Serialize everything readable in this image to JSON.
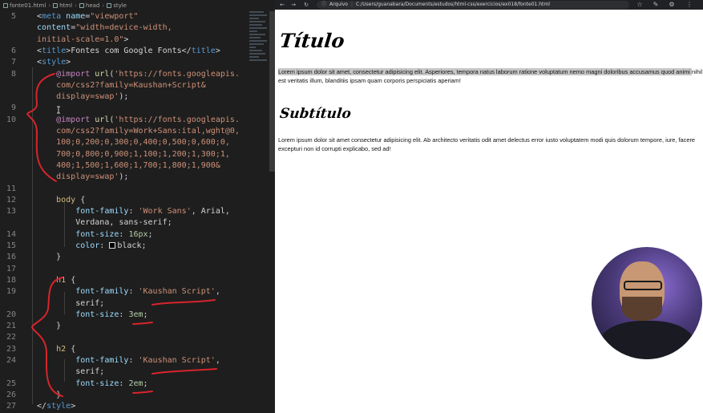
{
  "editor": {
    "breadcrumb": [
      "fonte01.html",
      "html",
      "head",
      "style"
    ],
    "lines": [
      {
        "n": "5",
        "segs": [
          [
            "punc",
            "  <"
          ],
          [
            "tag",
            "meta"
          ],
          [
            "attr",
            " name"
          ],
          [
            "punc",
            "="
          ],
          [
            "str",
            "\"viewport\""
          ]
        ]
      },
      {
        "n": "",
        "segs": [
          [
            "attr",
            "  content"
          ],
          [
            "punc",
            "="
          ],
          [
            "str",
            "\"width=device-width,"
          ]
        ]
      },
      {
        "n": "",
        "segs": [
          [
            "str",
            "  initial-scale=1.0\""
          ],
          [
            "punc",
            ">"
          ]
        ]
      },
      {
        "n": "6",
        "segs": [
          [
            "punc",
            "  <"
          ],
          [
            "tag",
            "title"
          ],
          [
            "punc",
            ">Fontes com Google Fonts</"
          ],
          [
            "tag",
            "title"
          ],
          [
            "punc",
            ">"
          ]
        ]
      },
      {
        "n": "7",
        "segs": [
          [
            "punc",
            "  <"
          ],
          [
            "tag",
            "style"
          ],
          [
            "punc",
            ">"
          ]
        ]
      },
      {
        "n": "8",
        "segs": [
          [
            "at",
            "      @import"
          ],
          [
            "fn",
            " url"
          ],
          [
            "punc",
            "("
          ],
          [
            "str",
            "'https://fonts.googleapis."
          ]
        ]
      },
      {
        "n": "",
        "segs": [
          [
            "str",
            "      com/css2?family=Kaushan+Script&"
          ]
        ]
      },
      {
        "n": "",
        "segs": [
          [
            "str",
            "      display=swap'"
          ],
          [
            "punc",
            ");"
          ]
        ]
      },
      {
        "n": "9",
        "segs": [
          [
            "punc",
            ""
          ]
        ]
      },
      {
        "n": "10",
        "segs": [
          [
            "at",
            "      @import"
          ],
          [
            "fn",
            " url"
          ],
          [
            "punc",
            "("
          ],
          [
            "str",
            "'https://fonts.googleapis."
          ]
        ]
      },
      {
        "n": "",
        "segs": [
          [
            "str",
            "      com/css2?family=Work+Sans:ital,wght@0,"
          ]
        ]
      },
      {
        "n": "",
        "segs": [
          [
            "str",
            "      100;0,200;0,300;0,400;0,500;0,600;0,"
          ]
        ]
      },
      {
        "n": "",
        "segs": [
          [
            "str",
            "      700;0,800;0,900;1,100;1,200;1,300;1,"
          ]
        ]
      },
      {
        "n": "",
        "segs": [
          [
            "str",
            "      400;1,500;1,600;1,700;1,800;1,900&"
          ]
        ]
      },
      {
        "n": "",
        "segs": [
          [
            "str",
            "      display=swap'"
          ],
          [
            "punc",
            ");"
          ]
        ]
      },
      {
        "n": "11",
        "segs": [
          [
            "punc",
            ""
          ]
        ]
      },
      {
        "n": "12",
        "segs": [
          [
            "sel",
            "      body"
          ],
          [
            "punc",
            " {"
          ]
        ]
      },
      {
        "n": "13",
        "segs": [
          [
            "prop",
            "          font-family"
          ],
          [
            "punc",
            ": "
          ],
          [
            "str",
            "'Work Sans'"
          ],
          [
            "punc",
            ", Arial,"
          ]
        ]
      },
      {
        "n": "",
        "segs": [
          [
            "punc",
            "          Verdana, sans-serif;"
          ]
        ]
      },
      {
        "n": "14",
        "segs": [
          [
            "prop",
            "          font-size"
          ],
          [
            "punc",
            ": "
          ],
          [
            "num",
            "16px"
          ],
          [
            "punc",
            ";"
          ]
        ]
      },
      {
        "n": "15",
        "segs": [
          [
            "prop",
            "          color"
          ],
          [
            "punc",
            ": "
          ],
          [
            "swatch",
            ""
          ],
          [
            "punc",
            "black;"
          ]
        ]
      },
      {
        "n": "16",
        "segs": [
          [
            "punc",
            "      }"
          ]
        ]
      },
      {
        "n": "17",
        "segs": [
          [
            "punc",
            ""
          ]
        ]
      },
      {
        "n": "18",
        "segs": [
          [
            "sel",
            "      h1"
          ],
          [
            "punc",
            " {"
          ]
        ]
      },
      {
        "n": "19",
        "segs": [
          [
            "prop",
            "          font-family"
          ],
          [
            "punc",
            ": "
          ],
          [
            "str",
            "'Kaushan Script'"
          ],
          [
            "punc",
            ","
          ]
        ]
      },
      {
        "n": "",
        "segs": [
          [
            "punc",
            "          serif;"
          ]
        ]
      },
      {
        "n": "20",
        "segs": [
          [
            "prop",
            "          font-size"
          ],
          [
            "punc",
            ": "
          ],
          [
            "num",
            "3em"
          ],
          [
            "punc",
            ";"
          ]
        ]
      },
      {
        "n": "21",
        "segs": [
          [
            "punc",
            "      }"
          ]
        ]
      },
      {
        "n": "22",
        "segs": [
          [
            "punc",
            ""
          ]
        ]
      },
      {
        "n": "23",
        "segs": [
          [
            "sel",
            "      h2"
          ],
          [
            "punc",
            " {"
          ]
        ]
      },
      {
        "n": "24",
        "segs": [
          [
            "prop",
            "          font-family"
          ],
          [
            "punc",
            ": "
          ],
          [
            "str",
            "'Kaushan Script'"
          ],
          [
            "punc",
            ","
          ]
        ]
      },
      {
        "n": "",
        "segs": [
          [
            "punc",
            "          serif;"
          ]
        ]
      },
      {
        "n": "25",
        "segs": [
          [
            "prop",
            "          font-size"
          ],
          [
            "punc",
            ": "
          ],
          [
            "num",
            "2em"
          ],
          [
            "punc",
            ";"
          ]
        ]
      },
      {
        "n": "26",
        "segs": [
          [
            "punc",
            "      }"
          ]
        ]
      },
      {
        "n": "27",
        "segs": [
          [
            "punc",
            "  </"
          ],
          [
            "tag",
            "style"
          ],
          [
            "punc",
            ">"
          ]
        ]
      }
    ]
  },
  "browser": {
    "nav": [
      "←",
      "→",
      "↻"
    ],
    "address_info": "ⓘ",
    "address_scheme": "Arquivo",
    "address_path": "C:/Users/guanabara/Documents/estudos/html-css/exercicios/ex018/fonte01.html",
    "icons": [
      "☆",
      "✎",
      "⚙",
      "⋮"
    ],
    "page": {
      "h1": "Título",
      "p1_selected": "Lorem ipsum dolor sit amet, consectetur adipisicing elit. Asperiores, tempora natus laborum ratione voluptatum nemo magni doloribus accusamus quod animi ",
      "p1_rest": "nihil est veritatis illum, blanditiis ipsam quam corporis perspiciatis aperiam!",
      "h2": "Subtítulo",
      "p2": "Lorem ipsum dolor sit amet consectetur adipisicing elit. Ab architecto veritatis odit amet delectus error iusto voluptatem modi quis dolorum tempore, iure, facere excepturi non id corrupti explicabo, sed ad!"
    }
  },
  "colors": {
    "annotation": "#d8242c",
    "editor_bg": "#1e1e1e",
    "selection": "#c7c7c7"
  }
}
